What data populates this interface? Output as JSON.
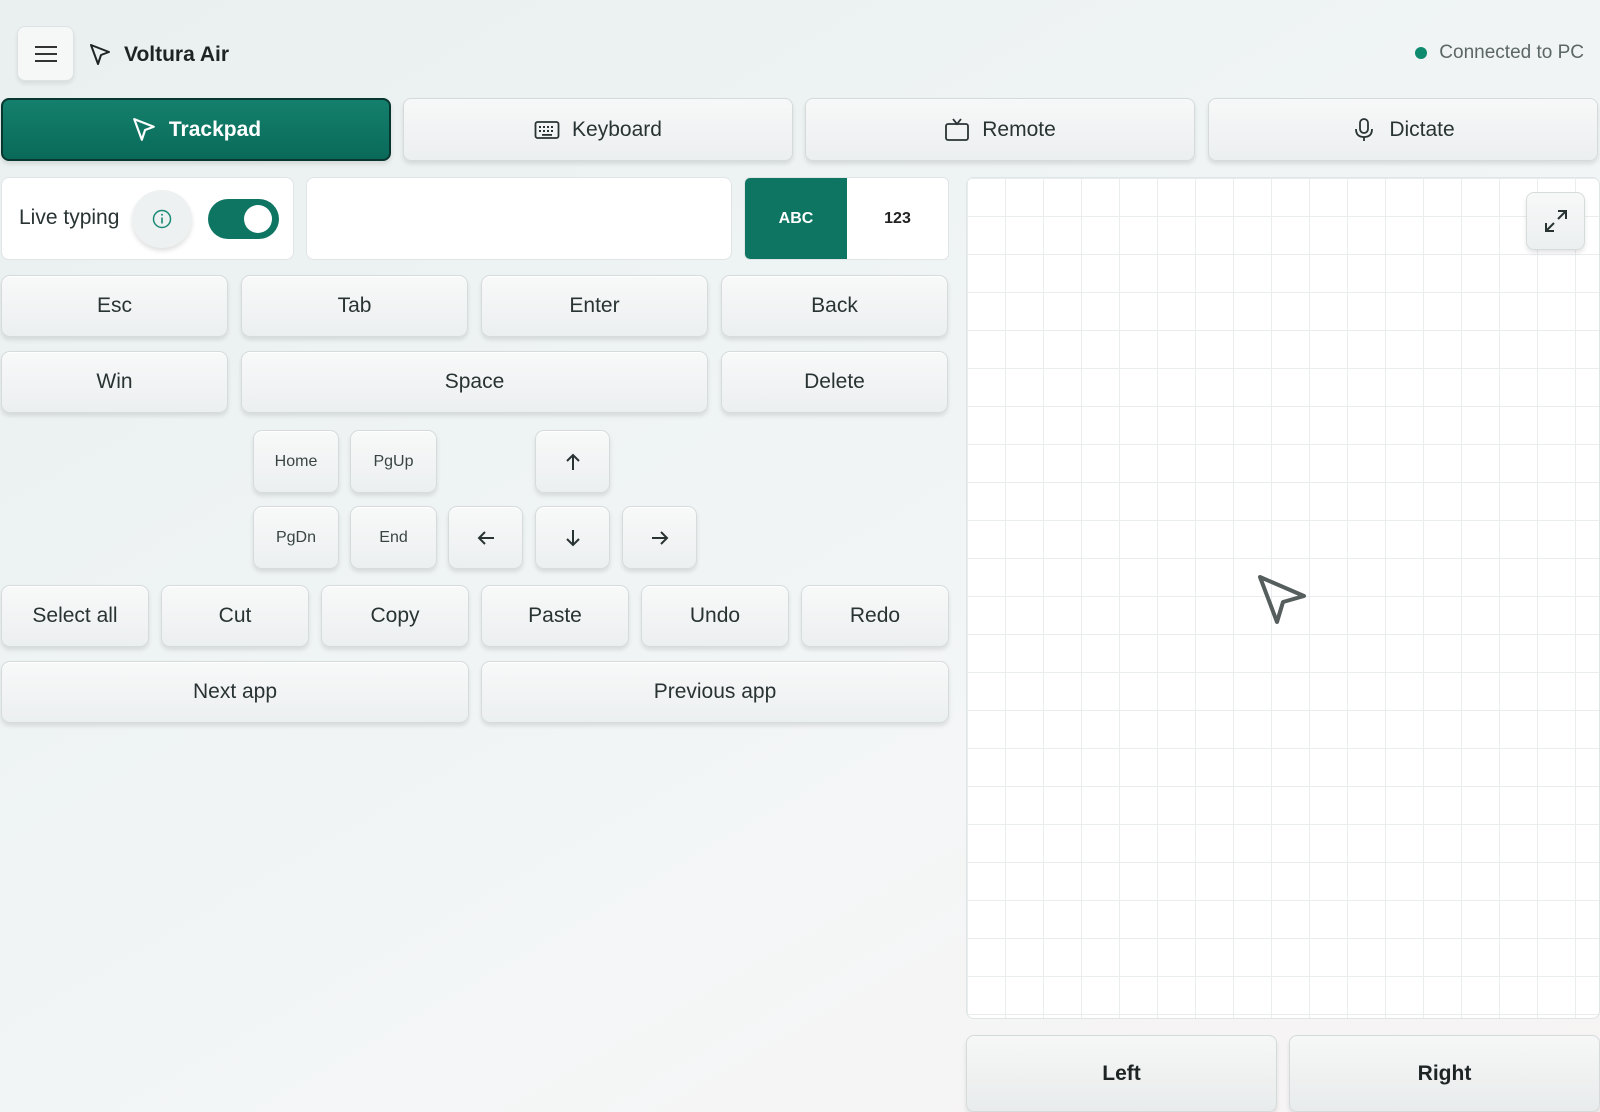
{
  "header": {
    "app_title": "Voltura Air",
    "status_text": "Connected to PC",
    "status_color": "#108a6e"
  },
  "tabs": [
    {
      "label": "Trackpad",
      "icon": "cursor-icon",
      "active": true
    },
    {
      "label": "Keyboard",
      "icon": "keyboard-icon",
      "active": false
    },
    {
      "label": "Remote",
      "icon": "tv-icon",
      "active": false
    },
    {
      "label": "Dictate",
      "icon": "microphone-icon",
      "active": false
    }
  ],
  "live_typing": {
    "label": "Live typing",
    "enabled": true,
    "input_value": "",
    "input_placeholder": ""
  },
  "mode": {
    "abc": "ABC",
    "num": "123",
    "selected": "ABC"
  },
  "keys": {
    "esc": "Esc",
    "tab": "Tab",
    "enter": "Enter",
    "back": "Back",
    "win": "Win",
    "space": "Space",
    "delete": "Delete",
    "home": "Home",
    "pgup": "PgUp",
    "pgdn": "PgDn",
    "end": "End",
    "select_all": "Select all",
    "cut": "Cut",
    "copy": "Copy",
    "paste": "Paste",
    "undo": "Undo",
    "redo": "Redo",
    "next_app": "Next app",
    "previous_app": "Previous app"
  },
  "trackpad": {
    "left_label": "Left",
    "right_label": "Right"
  },
  "colors": {
    "accent": "#0f7563"
  }
}
